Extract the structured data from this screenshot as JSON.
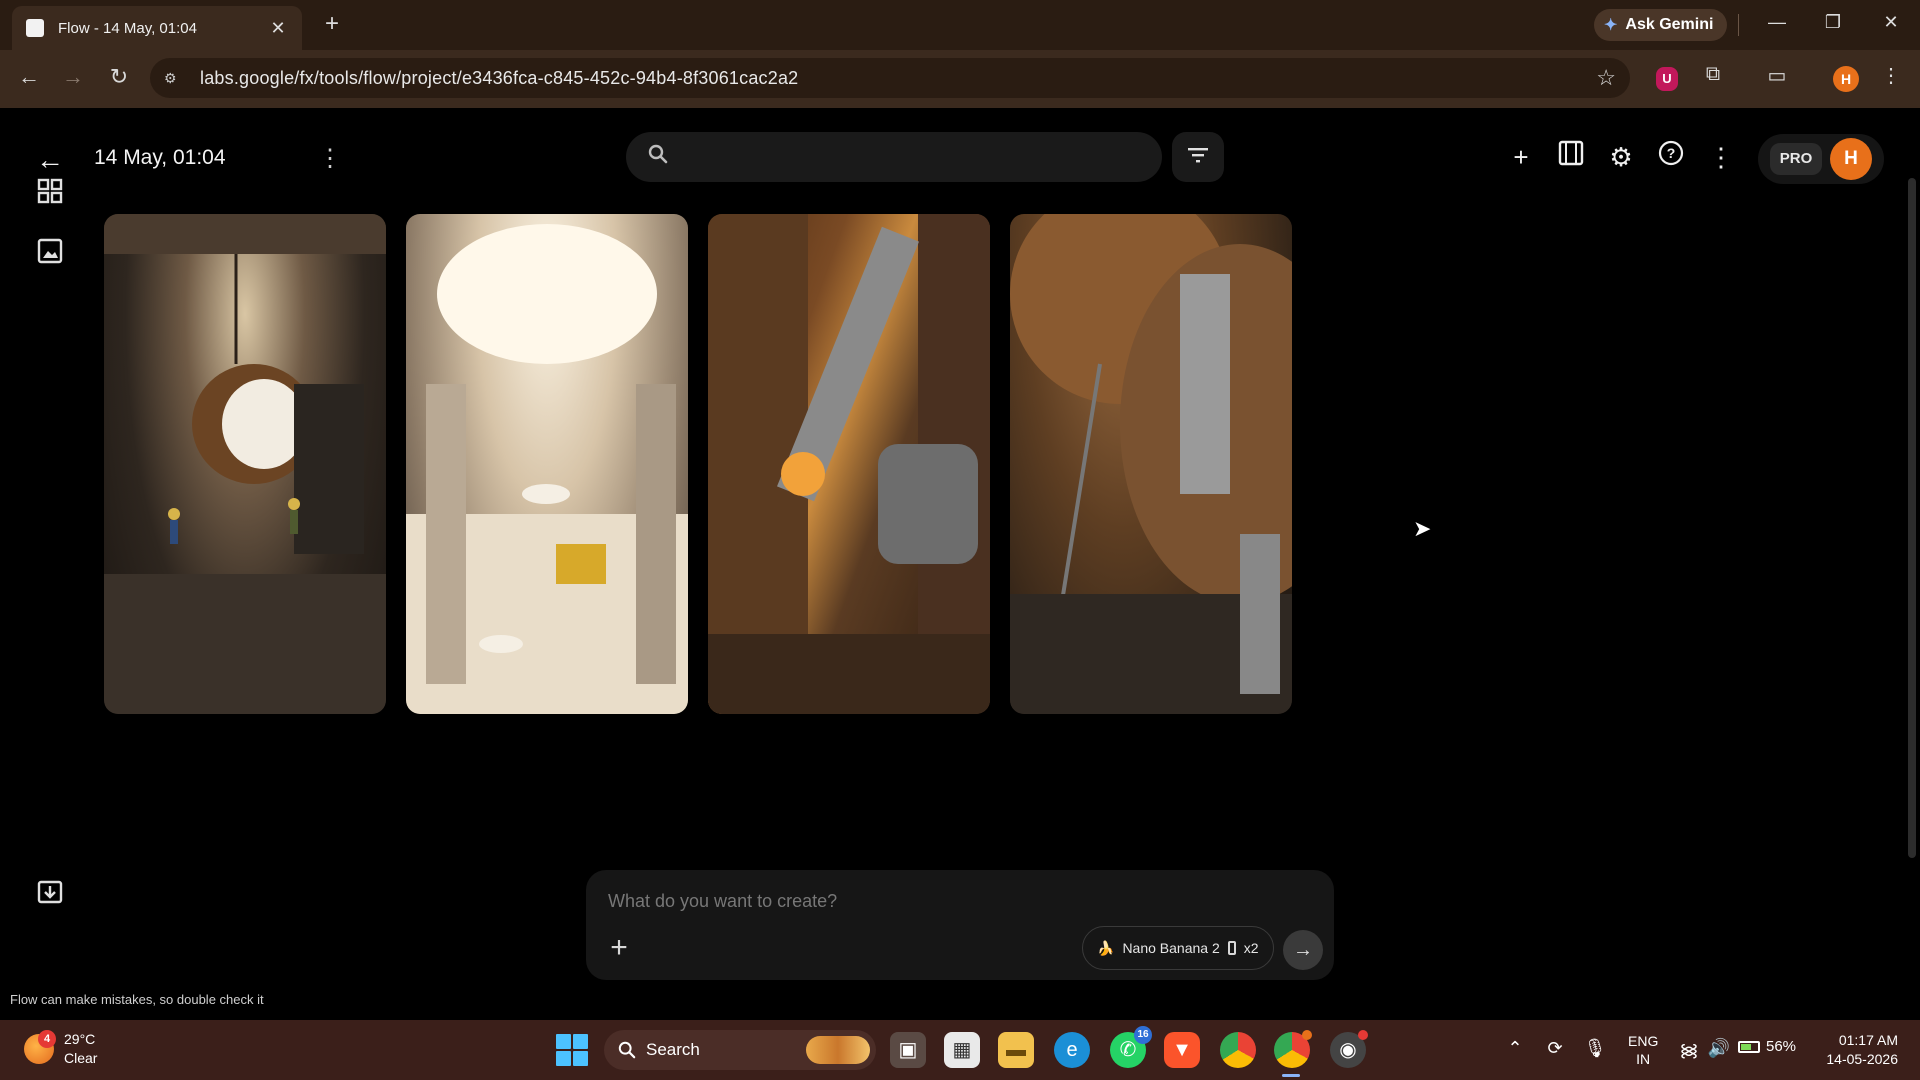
{
  "browser": {
    "tab_title": "Flow - 14 May, 01:04",
    "tab_close": "✕",
    "new_tab": "+",
    "ask_gemini": "Ask Gemini",
    "url": "labs.google/fx/tools/flow/project/e3436fca-c845-452c-94b4-8f3061cac2a2",
    "profile_initial": "H",
    "extension_ublock_label": "U"
  },
  "app": {
    "project_title": "14 May, 01:04",
    "search_placeholder": "",
    "pro_badge": "PRO",
    "avatar_initial": "H",
    "gallery": [
      {
        "id": "image-1"
      },
      {
        "id": "image-2"
      },
      {
        "id": "image-3"
      },
      {
        "id": "image-4"
      }
    ],
    "prompt": {
      "placeholder": "What do you want to create?",
      "model": "Nano Banana 2",
      "count": "x2"
    },
    "disclaimer": "Flow can make mistakes, so double check it"
  },
  "taskbar": {
    "weather_badge": "4",
    "temperature": "29°C",
    "condition": "Clear",
    "search_label": "Search",
    "whatsapp_badge": "16",
    "language_line1": "ENG",
    "language_line2": "IN",
    "battery": "56%",
    "time": "01:17 AM",
    "date": "14-05-2026"
  },
  "colors": {
    "accent_orange": "#e8701a",
    "page_background": "#000000",
    "chrome_dark": "#2a1c12",
    "taskbar": "#3b1f1a"
  }
}
